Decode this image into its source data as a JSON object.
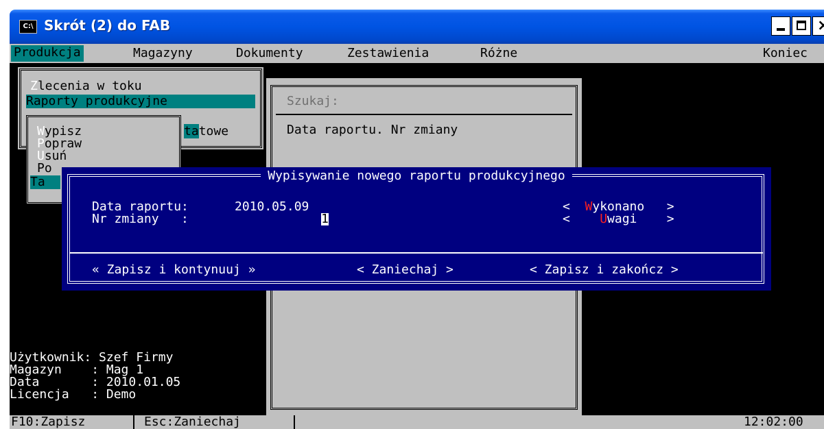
{
  "window": {
    "title": "Skrót (2) do FAB",
    "sys_icon": "C:\\"
  },
  "menubar": {
    "items": [
      "Produkcja",
      "Magazyny",
      "Dokumenty",
      "Zestawienia",
      "Różne"
    ],
    "right": "Koniec"
  },
  "submenu1": {
    "items": [
      "Zlecenia w toku",
      "Raporty produkcyjne",
      "tatowe"
    ],
    "hot_0": "Z",
    "rest_0": "lecenia w toku",
    "frag_hot": "ta",
    "frag_rest": "towe"
  },
  "submenu2": {
    "items": [
      {
        "hot": "W",
        "rest": "ypisz"
      },
      {
        "hot": "P",
        "rest": "opraw"
      },
      {
        "hot": "U",
        "rest": "suń"
      },
      {
        "hot": "",
        "rest": "Po"
      },
      {
        "hot": "",
        "rest": "Ta"
      }
    ]
  },
  "search": {
    "label": "Szukaj:",
    "field": "Data raportu. Nr zmiany"
  },
  "dialog": {
    "title": "Wypisywanie nowego raportu produkcyjnego",
    "date_label": "Data raportu:",
    "date_value": "2010.05.09",
    "shift_label": "Nr zmiany   :",
    "shift_value": "1",
    "btn_done": {
      "hot": "W",
      "rest": "ykonano"
    },
    "btn_notes": {
      "hot": "U",
      "rest": "wagi"
    },
    "save_continue": "« Zapisz i kontynuuj »",
    "cancel": "< Zaniechaj >",
    "save_close": "< Zapisz i zakończ >"
  },
  "info": {
    "user": "Użytkownik: Szef Firmy",
    "warehouse": "Magazyn    : Mag 1",
    "date": "Data       : 2010.01.05",
    "license": "Licencja   : Demo"
  },
  "statusbar": {
    "f10": "F10:Zapisz",
    "esc": "Esc:Zaniechaj",
    "clock": "12:02:00"
  }
}
